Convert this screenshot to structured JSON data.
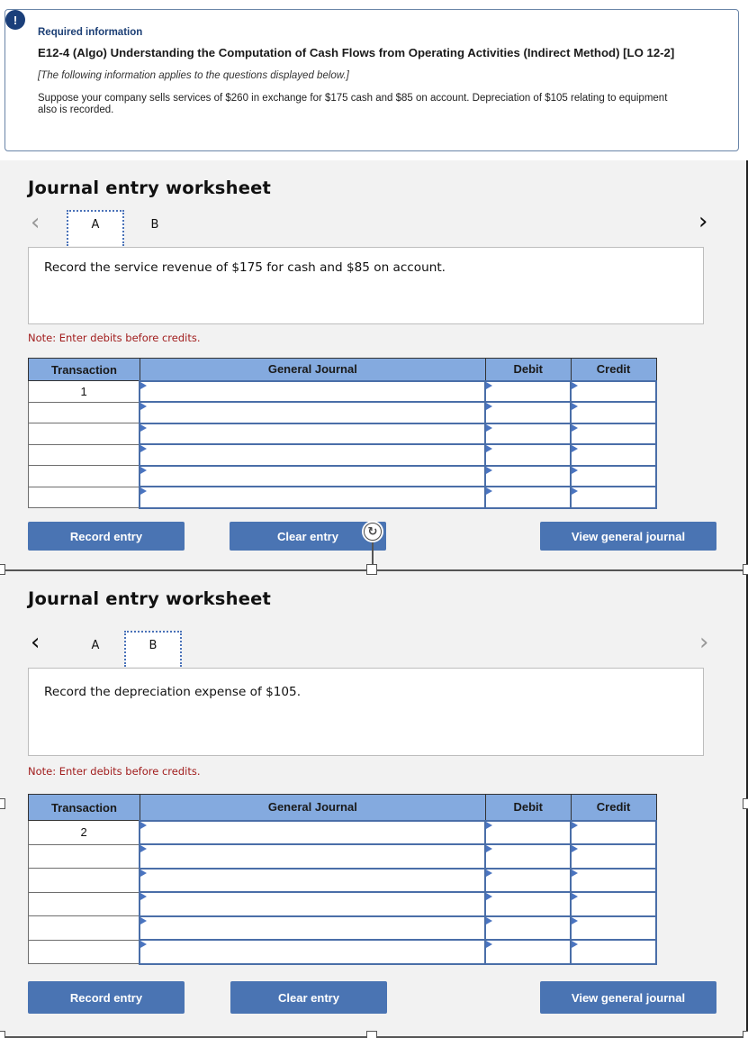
{
  "info": {
    "alert_icon": "!",
    "required_label": "Required information",
    "title": "E12-4 (Algo) Understanding the Computation of Cash Flows from Operating Activities (Indirect Method) [LO 12-2]",
    "instruction": "[The following information applies to the questions displayed below.]",
    "body": "Suppose your company sells services of $260 in exchange for $175 cash and $85 on account. Depreciation of $105 relating to equipment also is recorded."
  },
  "worksheets": [
    {
      "title": "Journal entry worksheet",
      "prev_icon": "‹",
      "next_icon": "›",
      "tabs": [
        "A",
        "B"
      ],
      "active_tab": "A",
      "prompt": "Record the service revenue of $175 for cash and $85 on account.",
      "note": "Note: Enter debits before credits.",
      "columns": [
        "Transaction",
        "General Journal",
        "Debit",
        "Credit"
      ],
      "rows": [
        {
          "transaction": "1",
          "account": "",
          "debit": "",
          "credit": ""
        },
        {
          "transaction": "",
          "account": "",
          "debit": "",
          "credit": ""
        },
        {
          "transaction": "",
          "account": "",
          "debit": "",
          "credit": ""
        },
        {
          "transaction": "",
          "account": "",
          "debit": "",
          "credit": ""
        },
        {
          "transaction": "",
          "account": "",
          "debit": "",
          "credit": ""
        },
        {
          "transaction": "",
          "account": "",
          "debit": "",
          "credit": ""
        }
      ],
      "buttons": {
        "record": "Record entry",
        "clear": "Clear entry",
        "view": "View general journal"
      }
    },
    {
      "title": "Journal entry worksheet",
      "prev_icon": "‹",
      "next_icon": "›",
      "tabs": [
        "A",
        "B"
      ],
      "active_tab": "B",
      "prompt": "Record the depreciation expense of $105.",
      "note": "Note: Enter debits before credits.",
      "columns": [
        "Transaction",
        "General Journal",
        "Debit",
        "Credit"
      ],
      "rows": [
        {
          "transaction": "2",
          "account": "",
          "debit": "",
          "credit": ""
        },
        {
          "transaction": "",
          "account": "",
          "debit": "",
          "credit": ""
        },
        {
          "transaction": "",
          "account": "",
          "debit": "",
          "credit": ""
        },
        {
          "transaction": "",
          "account": "",
          "debit": "",
          "credit": ""
        },
        {
          "transaction": "",
          "account": "",
          "debit": "",
          "credit": ""
        },
        {
          "transaction": "",
          "account": "",
          "debit": "",
          "credit": ""
        }
      ],
      "buttons": {
        "record": "Record entry",
        "clear": "Clear entry",
        "view": "View general journal"
      }
    }
  ],
  "overlay": {
    "rotate_icon": "↻"
  }
}
